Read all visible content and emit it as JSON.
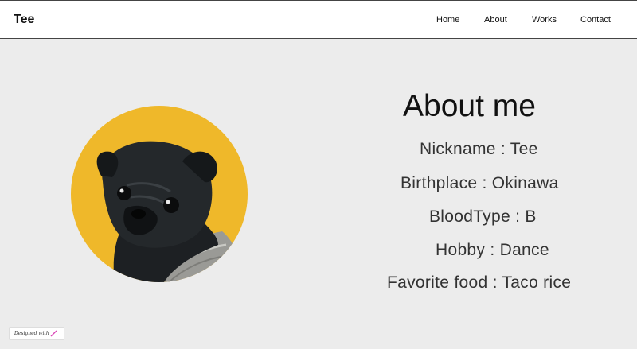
{
  "header": {
    "brand": "Tee",
    "nav": [
      "Home",
      "About",
      "Works",
      "Contact"
    ]
  },
  "about": {
    "title": "About me",
    "details": [
      "Nickname : Tee",
      "Birthplace : Okinawa",
      "BloodType : B",
      "Hobby : Dance",
      "Favorite food : Taco rice"
    ]
  },
  "badge": {
    "text": "Designed with"
  },
  "colors": {
    "background": "#ececec",
    "header": "#ffffff",
    "avatar_bg": "#efb82a",
    "badge_mark": "#d946b6"
  },
  "icons": {
    "avatar": "pug-photo",
    "badge": "pencil-icon"
  }
}
